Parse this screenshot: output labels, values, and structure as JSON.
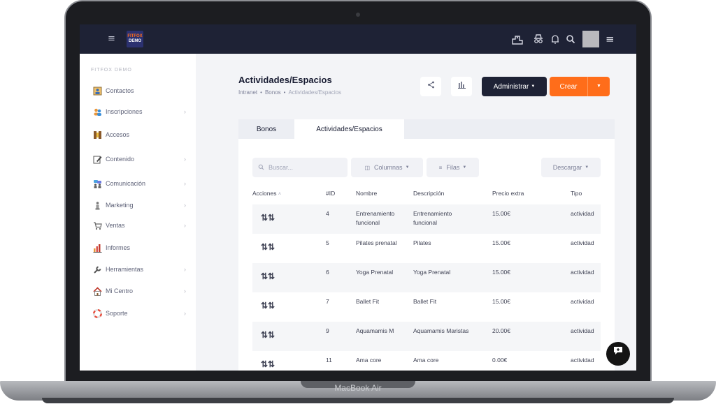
{
  "device": {
    "label": "MacBook Air"
  },
  "topbar": {
    "logo_line1": "FITFOX",
    "logo_line2": "DEMO"
  },
  "sidebar": {
    "org": "FITFOX DEMO",
    "items": [
      {
        "label": "Contactos",
        "icon": "contacts-icon",
        "chevron": false
      },
      {
        "label": "Inscripciones",
        "icon": "users-icon",
        "chevron": true
      },
      {
        "label": "Accesos",
        "icon": "door-icon",
        "chevron": false
      },
      {
        "label": "Contenido",
        "icon": "edit-icon",
        "chevron": true
      },
      {
        "label": "Comunicación",
        "icon": "chat-people-icon",
        "chevron": true
      },
      {
        "label": "Marketing",
        "icon": "megaphone-icon",
        "chevron": true
      },
      {
        "label": "Ventas",
        "icon": "cart-icon",
        "chevron": true
      },
      {
        "label": "Informes",
        "icon": "bar-chart-icon",
        "chevron": false
      },
      {
        "label": "Herramientas",
        "icon": "wrench-icon",
        "chevron": true
      },
      {
        "label": "Mi Centro",
        "icon": "house-icon",
        "chevron": true
      },
      {
        "label": "Soporte",
        "icon": "lifebuoy-icon",
        "chevron": true
      }
    ]
  },
  "header": {
    "title": "Actividades/Espacios",
    "breadcrumb": [
      "Intranet",
      "Bonos",
      "Actividades/Espacios"
    ],
    "admin_label": "Administrar",
    "create_label": "Crear"
  },
  "tabs": [
    "Bonos",
    "Actividades/Espacios"
  ],
  "toolbar": {
    "search_placeholder": "Buscar...",
    "columns_label": "Columnas",
    "rows_label": "Filas",
    "download_label": "Descargar"
  },
  "table": {
    "headers": [
      "Acciones",
      "#ID",
      "Nombre",
      "Descripción",
      "Precio extra",
      "Tipo"
    ],
    "rows": [
      {
        "id": "4",
        "name": "Entrenamiento funcional",
        "desc": "Entrenamiento funcional",
        "price": "15.00€",
        "type": "actividad"
      },
      {
        "id": "5",
        "name": "Pilates prenatal",
        "desc": "Pilates",
        "price": "15.00€",
        "type": "actividad"
      },
      {
        "id": "6",
        "name": "Yoga Prenatal",
        "desc": "Yoga Prenatal",
        "price": "15.00€",
        "type": "actividad"
      },
      {
        "id": "7",
        "name": "Ballet Fit",
        "desc": "Ballet Fit",
        "price": "15.00€",
        "type": "actividad"
      },
      {
        "id": "9",
        "name": "Aquamamis M",
        "desc": "Aquamamis Maristas",
        "price": "20.00€",
        "type": "actividad"
      },
      {
        "id": "11",
        "name": "Ama core",
        "desc": "Ama core",
        "price": "0.00€",
        "type": "actividad"
      }
    ]
  },
  "colors": {
    "topbar": "#1e2235",
    "accent": "#ff6d1a",
    "dark_button": "#1e2235"
  }
}
